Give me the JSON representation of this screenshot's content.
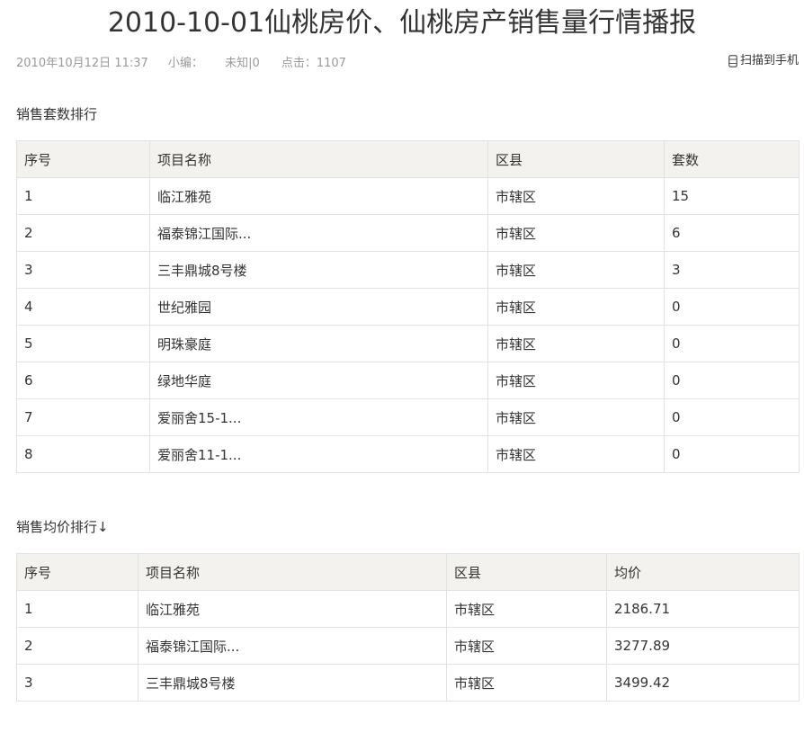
{
  "article": {
    "title": "2010-10-01仙桃房价、仙桃房产销售量行情播报",
    "date": "2010年10月12日 11:37",
    "editor_label": "小编：",
    "author": "未知|0",
    "clicks": "点击：1107",
    "scan_label": "扫描到手机"
  },
  "sales_count": {
    "title": "销售套数排行",
    "headers": [
      "序号",
      "项目名称",
      "区县",
      "套数"
    ],
    "rows": [
      [
        "1",
        "临江雅苑",
        "市辖区",
        "15"
      ],
      [
        "2",
        "福泰锦江国际...",
        "市辖区",
        "6"
      ],
      [
        "3",
        "三丰鼎城8号楼",
        "市辖区",
        "3"
      ],
      [
        "4",
        "世纪雅园",
        "市辖区",
        "0"
      ],
      [
        "5",
        "明珠豪庭",
        "市辖区",
        "0"
      ],
      [
        "6",
        "绿地华庭",
        "市辖区",
        "0"
      ],
      [
        "7",
        "爱丽舍15-1...",
        "市辖区",
        "0"
      ],
      [
        "8",
        "爱丽舍11-1...",
        "市辖区",
        "0"
      ]
    ]
  },
  "avg_price": {
    "title": "销售均价排行↓",
    "headers": [
      "序号",
      "项目名称",
      "区县",
      "均价"
    ],
    "rows": [
      [
        "1",
        "临江雅苑",
        "市辖区",
        "2186.71"
      ],
      [
        "2",
        "福泰锦江国际...",
        "市辖区",
        "3277.89"
      ],
      [
        "3",
        "三丰鼎城8号楼",
        "市辖区",
        "3499.42"
      ]
    ]
  },
  "icons": {
    "scan": "mobile-phone-icon"
  },
  "colors": {
    "text": "#333333",
    "meta_text": "#999999",
    "header_bg": "#f3f2ef",
    "border": "#e2e2e2"
  }
}
